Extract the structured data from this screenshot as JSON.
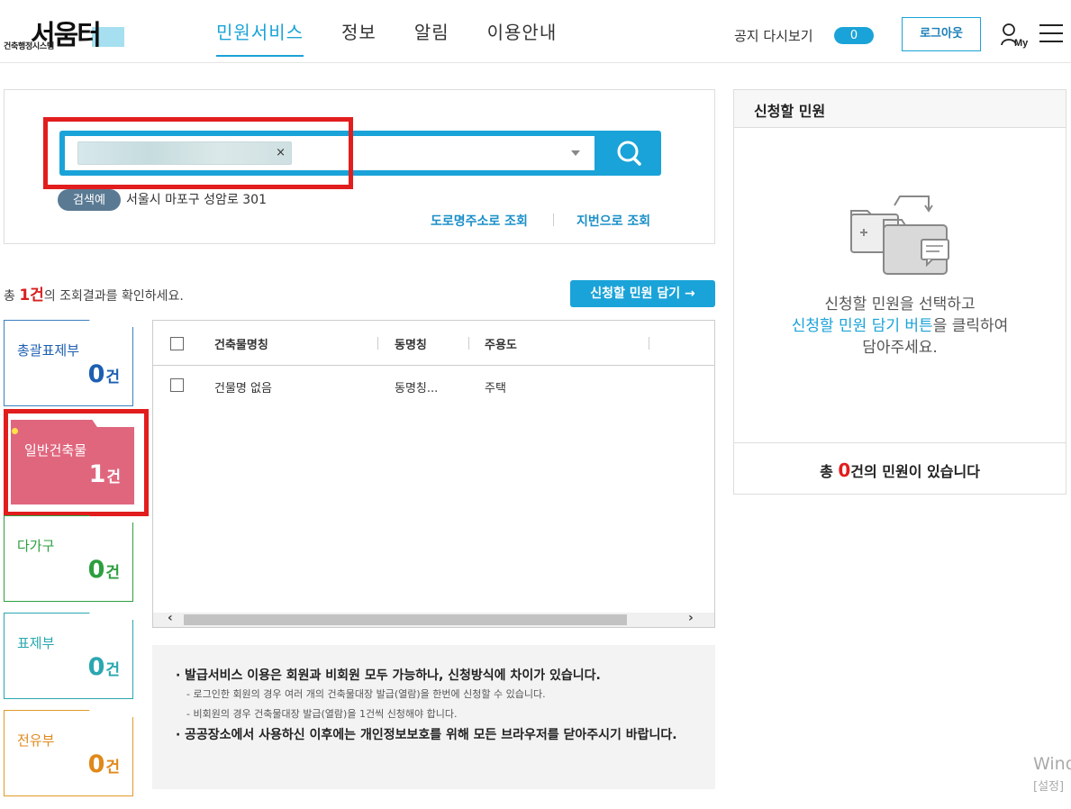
{
  "header": {
    "logo_word": "서움터",
    "logo_sub": "건축행정시스템",
    "menu": [
      {
        "label": "민원서비스",
        "active": true
      },
      {
        "label": "정보",
        "active": false
      },
      {
        "label": "알림",
        "active": false
      },
      {
        "label": "이용안내",
        "active": false
      }
    ],
    "notice_label": "공지 다시보기",
    "notice_count": "0",
    "logout_label": "로그아웃",
    "my_label": "My"
  },
  "search": {
    "chip_close": "×",
    "example_tag": "검색예",
    "example_text": "서울시 마포구 성암로 301",
    "link_road": "도로명주소로 조회",
    "link_jibun": "지번으로 조회"
  },
  "results": {
    "prefix": "총 ",
    "count": "1건",
    "suffix": "의 조회결과를 확인하세요.",
    "cart_button": "신청할 민원 담기 →"
  },
  "categories": [
    {
      "label": "총괄표제부",
      "count": "0",
      "unit": "건"
    },
    {
      "label": "일반건축물",
      "count": "1",
      "unit": "건"
    },
    {
      "label": "다가구",
      "count": "0",
      "unit": "건"
    },
    {
      "label": "표제부",
      "count": "0",
      "unit": "건"
    },
    {
      "label": "전유부",
      "count": "0",
      "unit": "건"
    }
  ],
  "table": {
    "headers": [
      "건축물명칭",
      "동명칭",
      "주용도"
    ],
    "rows": [
      {
        "name": "건물명 없음",
        "dong": "동명칭...",
        "use": "주택"
      }
    ]
  },
  "info": {
    "item1": "발급서비스 이용은 회원과 비회원 모두 가능하나, 신청방식에 차이가 있습니다.",
    "sub1": "- 로그인한 회원의 경우 여러 개의 건축물대장 발급(열람)을 한번에 신청할 수 있습니다.",
    "sub2": "- 비회원의 경우 건축물대장 발급(열람)을 1건씩 신청해야 합니다.",
    "item2": "공공장소에서 사용하신 이후에는 개인정보보호를 위해 모든 브라우저를 닫아주시기 바랍니다."
  },
  "cart": {
    "title": "신청할 민원",
    "msg_line1": "신청할 민원을 선택하고",
    "msg_hl": "신청할 민원 담기 버튼",
    "msg_line2_rest": "을 클릭하여",
    "msg_line3": "담아주세요.",
    "foot_prefix": "총 ",
    "foot_count": "0",
    "foot_suffix": "건의 민원이 있습니다"
  },
  "watermark": {
    "line1": "Wind",
    "line2": "[설정]"
  },
  "colors": {
    "accent": "#1aa3d8",
    "highlight_red": "#e21d1d",
    "general_card": "#e0667e"
  }
}
